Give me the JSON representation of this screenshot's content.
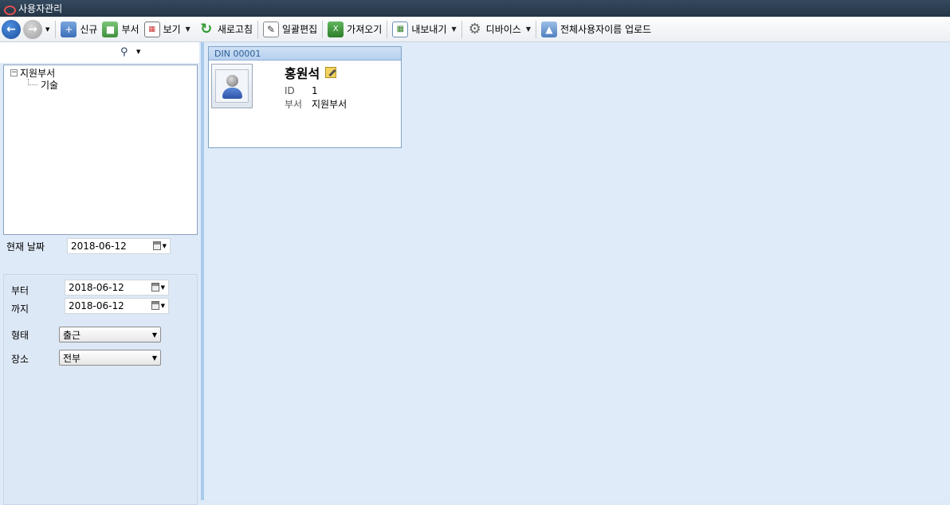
{
  "window": {
    "title": "사용자관리"
  },
  "toolbar": {
    "new_label": "신규",
    "dept_label": "부서",
    "view_label": "보기",
    "refresh_label": "새로고침",
    "bulk_edit_label": "일괄편집",
    "import_label": "가져오기",
    "export_label": "내보내기",
    "device_label": "디바이스",
    "upload_all_label": "전체사용자이름 업로드"
  },
  "tree": {
    "root_label": "지원부서",
    "child_label": "기술"
  },
  "current_date": {
    "label": "현재 날짜",
    "value": "2018-06-12"
  },
  "filters": {
    "from_label": "부터",
    "from_value": "2018-06-12",
    "to_label": "까지",
    "to_value": "2018-06-12",
    "type_label": "형태",
    "type_value": "출근",
    "place_label": "장소",
    "place_value": "전부"
  },
  "user_card": {
    "din": "DIN  00001",
    "name": "홍원석",
    "id_label": "ID",
    "id_value": "1",
    "dept_label": "부서",
    "dept_value": "지원부서"
  },
  "colors": {
    "titlebar": "#2c3e50",
    "panel_bg": "#dfeaf8",
    "splitter": "#a9cbec",
    "card_header": "#c4d9f2"
  }
}
